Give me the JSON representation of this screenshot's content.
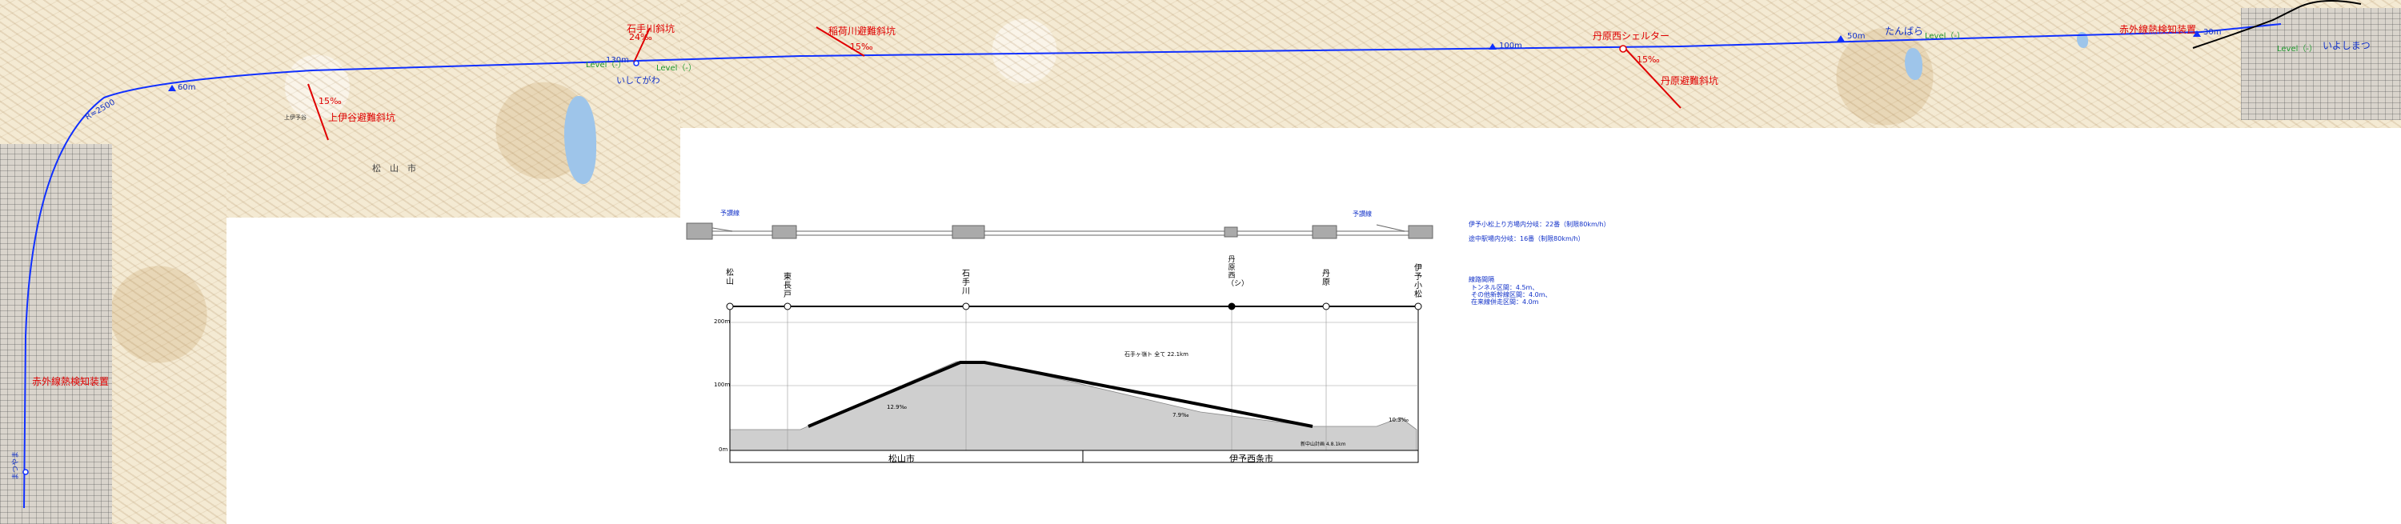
{
  "map": {
    "station_labels": {
      "iyoshi": "いよしまつ",
      "tanbara": "たんばら",
      "ishiteg": "いしてがわ",
      "matsu": "まつやま"
    },
    "place_labels": {
      "matsuyama_city": "松　山　市",
      "kamiiyotani": "上伊予谷"
    },
    "facility_labels": {
      "ishite_tunnel": "石手川斜坑",
      "ishite_grade": "24‰",
      "fushiga_tunnel": "稲荷川避難斜坑",
      "fushiga_grade": "15‰",
      "kami_tunnel": "上伊谷避難斜坑",
      "kami_grade": "15‰",
      "tanbara_shelter": "丹原西シェルター",
      "tanbara_grade": "15‰",
      "tanbara_tunnel": "丹原避難斜坑",
      "hotbox_east": "赤外線熱検知装置",
      "hotbox_west": "赤外線熱検知装置"
    },
    "level_labels": [
      "Level（-）",
      "Level（-）",
      "Level（-）",
      "Level（-）"
    ],
    "elevation_labels": [
      "60m",
      "130m",
      "100m",
      "50m",
      "30m"
    ],
    "curve_label": "R=2500"
  },
  "track": {
    "left_label": "予讃線",
    "right_label": "予讃線",
    "speed_note_1": "伊予小松上り方場内分岐：22番（制限80km/h）",
    "speed_note_2": "途中駅場内分岐：16番（制限80km/h）",
    "spacing_title": "線路間隔",
    "spacing_1": "トンネル区間：4.5m、",
    "spacing_2": "その他新幹線区間：4.0m、",
    "spacing_3": "在来線併走区間：4.0m"
  },
  "profile": {
    "stations": [
      {
        "name": "松山"
      },
      {
        "name": "東長戸"
      },
      {
        "name": "石手川"
      },
      {
        "name": "丹原西（シ）"
      },
      {
        "name": "丹原"
      },
      {
        "name": "伊予小松"
      }
    ],
    "y_ticks": [
      "200m",
      "100m",
      "0m"
    ],
    "gradients": [
      "12.9‰",
      "7.9‰",
      "10.3‰"
    ],
    "tunnel_note": "石手ヶ嶺ト 全て 22.1km",
    "bottom_note": "新中山計画 4.8.1km",
    "cities": [
      "松山市",
      "伊予西条市"
    ]
  }
}
